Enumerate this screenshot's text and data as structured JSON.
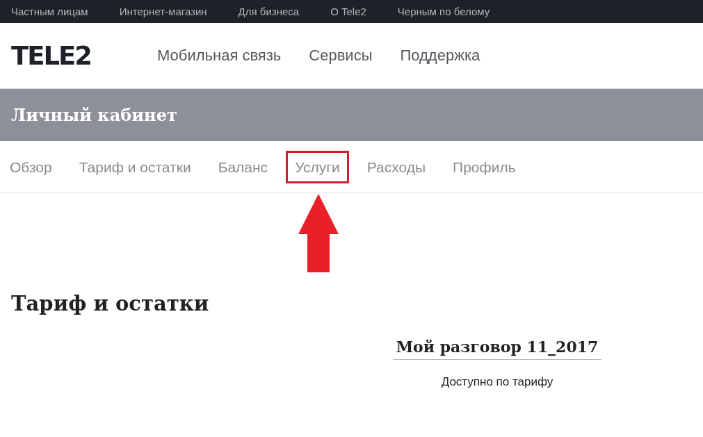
{
  "top_bar": {
    "links": [
      "Частным лицам",
      "Интернет-магазин",
      "Для бизнеса",
      "О Tele2",
      "Черным по белому"
    ]
  },
  "header": {
    "logo": "TELE2",
    "nav": [
      "Мобильная связь",
      "Сервисы",
      "Поддержка"
    ]
  },
  "account_bar": {
    "title": "Личный кабинет"
  },
  "tabs": [
    {
      "label": "Обзор",
      "highlighted": false
    },
    {
      "label": "Тариф и остатки",
      "highlighted": false
    },
    {
      "label": "Баланс",
      "highlighted": false
    },
    {
      "label": "Услуги",
      "highlighted": true
    },
    {
      "label": "Расходы",
      "highlighted": false
    },
    {
      "label": "Профиль",
      "highlighted": false
    }
  ],
  "section": {
    "title": "Тариф и остатки",
    "tariff": {
      "name": "Мой разговор 11_2017",
      "note": "Доступно по тарифу"
    }
  }
}
